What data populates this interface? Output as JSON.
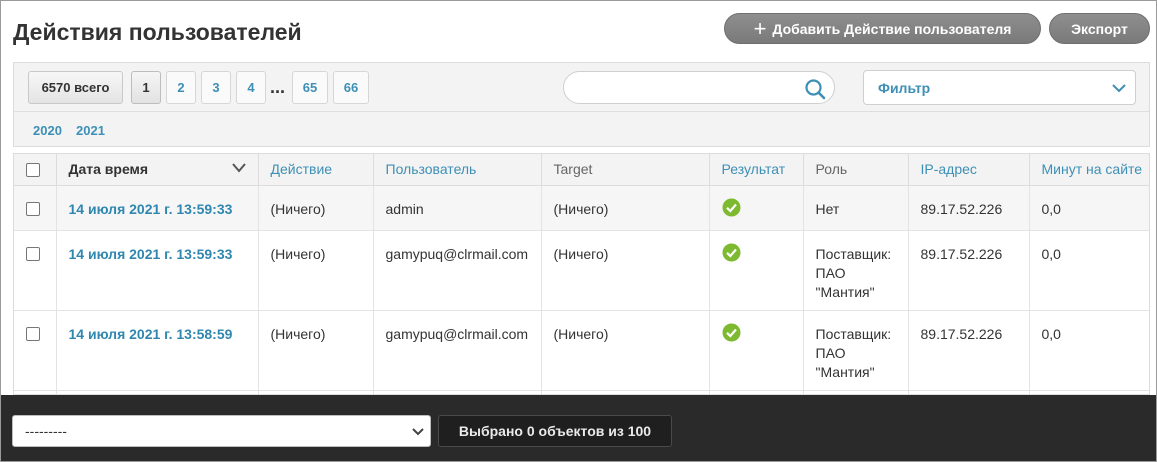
{
  "header": {
    "title": "Действия пользователей",
    "add_button_label": "Добавить Действие пользователя",
    "export_button_label": "Экспорт"
  },
  "toolbar": {
    "total_label": "6570 всего",
    "pages": [
      "1",
      "2",
      "3",
      "4",
      "65",
      "66"
    ],
    "current_page": "1",
    "ellipsis": "...",
    "search_value": "",
    "filter_label": "Фильтр",
    "years": [
      "2020",
      "2021"
    ]
  },
  "table": {
    "columns": [
      "Дата время",
      "Действие",
      "Пользователь",
      "Target",
      "Результат",
      "Роль",
      "IP-адрес",
      "Минут на сайте"
    ],
    "rows": [
      {
        "datetime": "14 июля 2021 г. 13:59:33",
        "action": "(Ничего)",
        "user": "admin",
        "target": "(Ничего)",
        "role": [
          "Нет"
        ],
        "ip": "89.17.52.226",
        "minutes": "0,0"
      },
      {
        "datetime": "14 июля 2021 г. 13:59:33",
        "action": "(Ничего)",
        "user": "gamypuq@clrmail.com",
        "target": "(Ничего)",
        "role": [
          "Поставщик:",
          "ПАО",
          "\"Мантия\""
        ],
        "ip": "89.17.52.226",
        "minutes": "0,0"
      },
      {
        "datetime": "14 июля 2021 г. 13:58:59",
        "action": "(Ничего)",
        "user": "gamypuq@clrmail.com",
        "target": "(Ничего)",
        "role": [
          "Поставщик:",
          "ПАО",
          "\"Мантия\""
        ],
        "ip": "89.17.52.226",
        "minutes": "0,0"
      }
    ]
  },
  "bottom_bar": {
    "action_select_value": "---------",
    "selected_count_label": "Выбрано 0 объектов из 100"
  },
  "colors": {
    "accent": "#3d8fb6",
    "success": "#7dba2f",
    "bottom_bar": "#2a2a2a"
  }
}
